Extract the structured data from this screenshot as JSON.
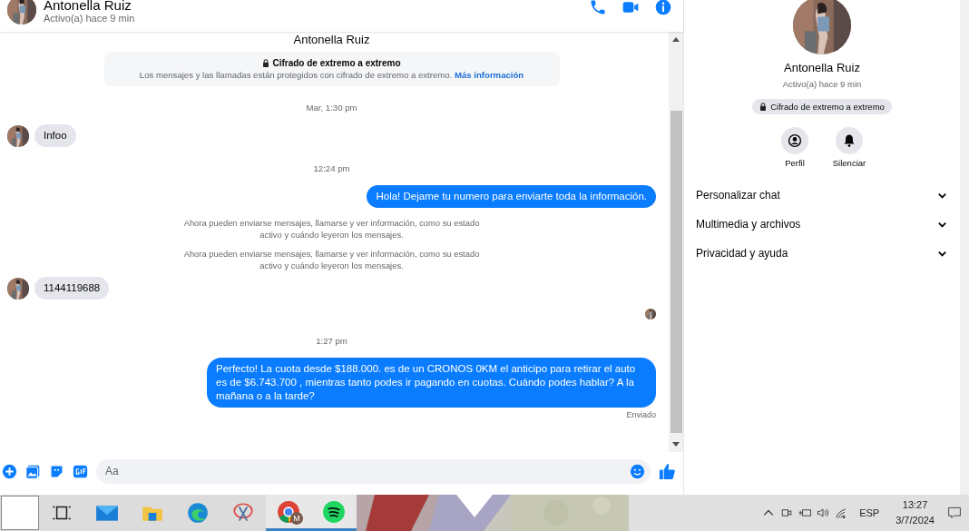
{
  "header": {
    "name": "Antonella Ruiz",
    "status": "Activo(a) hace 9 min"
  },
  "chat": {
    "cut_title": "Antonella Ruiz",
    "messages": [
      {
        "kind": "encryption",
        "title": "Cifrado de extremo a extremo",
        "text": "Los mensajes y las llamadas están protegidos con cifrado de extremo a extremo.",
        "link": "Más información"
      },
      {
        "kind": "time",
        "text": "Mar, 1:30 pm"
      },
      {
        "kind": "in",
        "text": "Infoo"
      },
      {
        "kind": "time",
        "text": "12:24 pm"
      },
      {
        "kind": "out",
        "text": "Hola! Dejame tu numero  para enviarte toda la información."
      },
      {
        "kind": "notice",
        "text": "Ahora pueden enviarse mensajes, llamarse y ver información, como su estado activo y cuándo leyeron los mensajes."
      },
      {
        "kind": "notice",
        "text": "Ahora pueden enviarse mensajes, llamarse y ver información, como su estado activo y cuándo leyeron los mensajes."
      },
      {
        "kind": "in",
        "text": "1144119688"
      },
      {
        "kind": "seen"
      },
      {
        "kind": "time",
        "text": "1:27 pm"
      },
      {
        "kind": "out",
        "text": "Perfecto! La cuota desde $188.000. es de un CRONOS 0KM el anticipo para retirar el auto es de $6.743.700 , mientras tanto podes ir pagando en cuotas. Cuándo podes hablar? A la mañana o a la tarde?"
      },
      {
        "kind": "status",
        "text": "Enviado"
      }
    ]
  },
  "composer": {
    "placeholder": "Aa"
  },
  "profile": {
    "name": "Antonella Ruiz",
    "status": "Activo(a) hace 9 min",
    "badge": "Cifrado de extremo a extremo",
    "actions": [
      {
        "kind": "profile",
        "label": "Perfil"
      },
      {
        "kind": "mute",
        "label": "Silenciar"
      }
    ],
    "sections": [
      {
        "label": "Personalizar chat",
        "expanded": false
      },
      {
        "label": "Multimedia y archivos",
        "expanded": false
      },
      {
        "label": "Privacidad y ayuda",
        "expanded": false
      }
    ]
  },
  "taskbar": {
    "apps": [
      {
        "kind": "taskview",
        "active": false
      },
      {
        "kind": "mail",
        "active": false
      },
      {
        "kind": "folder",
        "active": false
      },
      {
        "kind": "edge",
        "active": false
      },
      {
        "kind": "snip",
        "active": false
      },
      {
        "kind": "chrome",
        "active": true,
        "badge": "M"
      },
      {
        "kind": "spotify",
        "active": true
      }
    ],
    "language": "ESP",
    "time": "13:27",
    "date": "3/7/2024"
  }
}
